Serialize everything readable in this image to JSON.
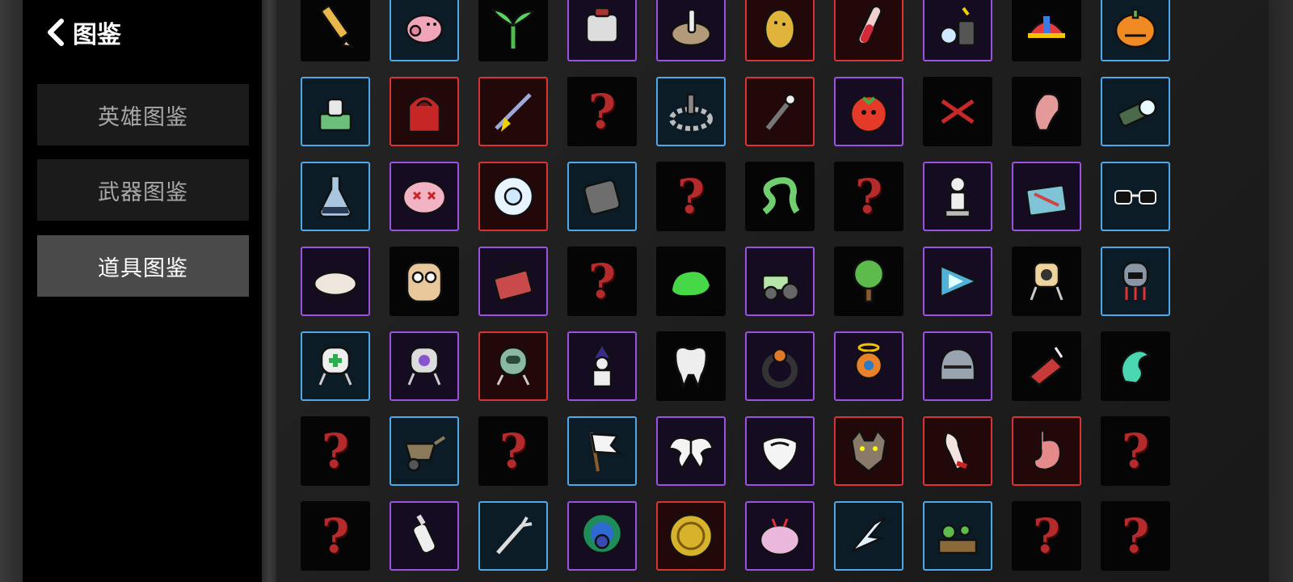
{
  "header": {
    "title": "图鉴"
  },
  "tabs": [
    {
      "label": "英雄图鉴",
      "active": false
    },
    {
      "label": "武器图鉴",
      "active": false
    },
    {
      "label": "道具图鉴",
      "active": true
    }
  ],
  "unknown_glyph": "?",
  "colors": {
    "blue": "#4fa8e8",
    "purple": "#9b52e0",
    "red": "#d83434",
    "unknown": "#b52a2a"
  },
  "items": [
    [
      {
        "icon": "pencil-icon",
        "rarity": "none"
      },
      {
        "icon": "piggy-bank-icon",
        "rarity": "blue"
      },
      {
        "icon": "sprout-icon",
        "rarity": "none"
      },
      {
        "icon": "bandage-icon",
        "rarity": "purple"
      },
      {
        "icon": "mortar-icon",
        "rarity": "purple"
      },
      {
        "icon": "potato-icon",
        "rarity": "red"
      },
      {
        "icon": "test-tube-icon",
        "rarity": "red"
      },
      {
        "icon": "chemistry-kit-icon",
        "rarity": "purple"
      },
      {
        "icon": "propeller-cap-icon",
        "rarity": "none"
      },
      {
        "icon": "pumpkin-icon",
        "rarity": "blue"
      }
    ],
    [
      {
        "icon": "turret-icon",
        "rarity": "blue"
      },
      {
        "icon": "red-hoodie-icon",
        "rarity": "red"
      },
      {
        "icon": "lightning-rod-icon",
        "rarity": "red"
      },
      {
        "icon": "unknown",
        "rarity": "none"
      },
      {
        "icon": "stone-circle-icon",
        "rarity": "blue"
      },
      {
        "icon": "sprinkler-icon",
        "rarity": "red"
      },
      {
        "icon": "tomato-icon",
        "rarity": "purple"
      },
      {
        "icon": "red-claw-icon",
        "rarity": "none"
      },
      {
        "icon": "ear-icon",
        "rarity": "none"
      },
      {
        "icon": "flashlight-icon",
        "rarity": "blue"
      }
    ],
    [
      {
        "icon": "flask-icon",
        "rarity": "blue"
      },
      {
        "icon": "dead-face-icon",
        "rarity": "purple"
      },
      {
        "icon": "gem-eye-icon",
        "rarity": "red"
      },
      {
        "icon": "barrel-icon",
        "rarity": "blue"
      },
      {
        "icon": "unknown",
        "rarity": "none"
      },
      {
        "icon": "snake-icon",
        "rarity": "none"
      },
      {
        "icon": "unknown",
        "rarity": "none"
      },
      {
        "icon": "statue-icon",
        "rarity": "purple"
      },
      {
        "icon": "scrap-pile-icon",
        "rarity": "purple"
      },
      {
        "icon": "sunglasses-icon",
        "rarity": "blue"
      }
    ],
    [
      {
        "icon": "tardigrade-icon",
        "rarity": "purple"
      },
      {
        "icon": "owl-icon",
        "rarity": "none"
      },
      {
        "icon": "toolbox-icon",
        "rarity": "purple"
      },
      {
        "icon": "unknown",
        "rarity": "none"
      },
      {
        "icon": "slime-icon",
        "rarity": "none"
      },
      {
        "icon": "tractor-icon",
        "rarity": "purple"
      },
      {
        "icon": "tree-icon",
        "rarity": "none"
      },
      {
        "icon": "triangle-crystal-icon",
        "rarity": "purple"
      },
      {
        "icon": "yellow-robot-icon",
        "rarity": "none"
      },
      {
        "icon": "grey-robot-icon",
        "rarity": "blue"
      }
    ],
    [
      {
        "icon": "medic-robot-icon",
        "rarity": "blue"
      },
      {
        "icon": "purple-robot-icon",
        "rarity": "purple"
      },
      {
        "icon": "green-robot-icon",
        "rarity": "red"
      },
      {
        "icon": "wizard-icon",
        "rarity": "purple"
      },
      {
        "icon": "tooth-icon",
        "rarity": "none"
      },
      {
        "icon": "ring-icon",
        "rarity": "purple"
      },
      {
        "icon": "angel-robot-icon",
        "rarity": "purple"
      },
      {
        "icon": "knight-helmet-icon",
        "rarity": "purple"
      },
      {
        "icon": "bloody-hand-icon",
        "rarity": "none"
      },
      {
        "icon": "spirit-icon",
        "rarity": "none"
      }
    ],
    [
      {
        "icon": "unknown",
        "rarity": "none"
      },
      {
        "icon": "wheelbarrow-icon",
        "rarity": "blue"
      },
      {
        "icon": "unknown",
        "rarity": "none"
      },
      {
        "icon": "white-flag-icon",
        "rarity": "blue"
      },
      {
        "icon": "wings-icon",
        "rarity": "purple"
      },
      {
        "icon": "beard-icon",
        "rarity": "purple"
      },
      {
        "icon": "wolf-head-icon",
        "rarity": "red"
      },
      {
        "icon": "torn-arm-icon",
        "rarity": "red"
      },
      {
        "icon": "stomach-icon",
        "rarity": "red"
      },
      {
        "icon": "unknown",
        "rarity": "none"
      }
    ],
    [
      {
        "icon": "unknown",
        "rarity": "none"
      },
      {
        "icon": "baby-bottle-icon",
        "rarity": "purple"
      },
      {
        "icon": "grabber-icon",
        "rarity": "blue"
      },
      {
        "icon": "peacock-icon",
        "rarity": "purple"
      },
      {
        "icon": "gold-coin-icon",
        "rarity": "red"
      },
      {
        "icon": "brain-bug-icon",
        "rarity": "purple"
      },
      {
        "icon": "shards-icon",
        "rarity": "blue"
      },
      {
        "icon": "garden-bed-icon",
        "rarity": "blue"
      },
      {
        "icon": "unknown",
        "rarity": "none"
      },
      {
        "icon": "unknown",
        "rarity": "none"
      }
    ]
  ]
}
